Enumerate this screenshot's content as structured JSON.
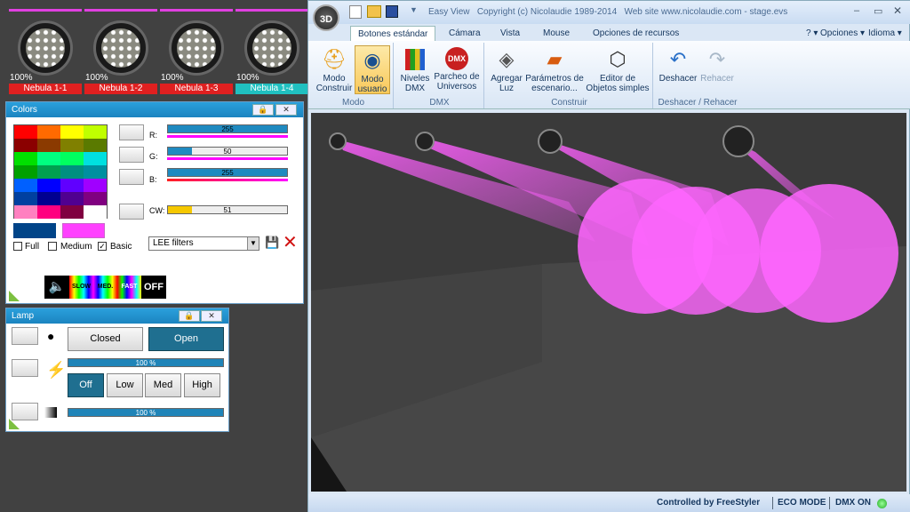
{
  "fixtures": [
    {
      "name": "Nebula 1-1",
      "pct": "100%",
      "selected": false
    },
    {
      "name": "Nebula 1-2",
      "pct": "100%",
      "selected": false
    },
    {
      "name": "Nebula 1-3",
      "pct": "100%",
      "selected": false
    },
    {
      "name": "Nebula 1-4",
      "pct": "100%",
      "selected": true
    }
  ],
  "colors_panel": {
    "title": "Colors",
    "channels": [
      {
        "label": "R:",
        "value": "255",
        "level": 1.0,
        "color": "#ff00ff"
      },
      {
        "label": "G:",
        "value": "50",
        "level": 0.2,
        "color": "#ff00ff"
      },
      {
        "label": "B:",
        "value": "255",
        "level": 1.0,
        "color": "#ff0080"
      }
    ],
    "cw": {
      "label": "CW:",
      "value": "51",
      "level": 0.2
    },
    "palette": [
      "#ff0000",
      "#ff6a00",
      "#ffff00",
      "#c0ff00",
      "#8b0000",
      "#8b3a00",
      "#808000",
      "#5a7a00",
      "#00e000",
      "#00ff80",
      "#00ff60",
      "#00e0e0",
      "#00a000",
      "#00a050",
      "#009080",
      "#0090a0",
      "#0060ff",
      "#0000ff",
      "#6000ff",
      "#a000ff",
      "#0040a0",
      "#000090",
      "#500090",
      "#800080",
      "#ff80c0",
      "#ff0080",
      "#800040",
      "#ffffff"
    ],
    "current_swatch": "#004488",
    "preview_swatch": "#ff40ff",
    "filter_options": {
      "full": "Full",
      "medium": "Medium",
      "basic": "Basic"
    },
    "basic_checked": true,
    "filter_select": "LEE filters",
    "speed_labels": [
      "SLOW",
      "MED.",
      "FAST",
      "OFF"
    ]
  },
  "lamp_panel": {
    "title": "Lamp",
    "closed_label": "Closed",
    "open_label": "Open",
    "shutter_value": "100 %",
    "shutter_level": 1.0,
    "power_buttons": [
      "Off",
      "Low",
      "Med",
      "High"
    ],
    "power_active": "Off",
    "dimmer_value": "100 %",
    "dimmer_level": 1.0
  },
  "window": {
    "title": "Easy View   Copyright (c) Nicolaudie 1989-2014   Web site www.nicolaudie.com - stage.evs",
    "tabs": [
      "Botones estándar",
      "Cámara",
      "Vista",
      "Mouse",
      "Opciones de recursos"
    ],
    "help": "?",
    "options": "Opciones",
    "language": "Idioma",
    "groups": {
      "modo": {
        "label": "Modo",
        "buttons": [
          {
            "l1": "Modo",
            "l2": "Construir",
            "icon": "hardhat-icon"
          },
          {
            "l1": "Modo",
            "l2": "usuario",
            "icon": "eye-icon"
          }
        ]
      },
      "dmx": {
        "label": "DMX",
        "buttons": [
          {
            "l1": "Niveles",
            "l2": "DMX",
            "icon": "levels-icon"
          },
          {
            "l1": "Parcheo de",
            "l2": "Universos",
            "icon": "dmx-patch-icon"
          }
        ]
      },
      "construir": {
        "label": "Construir",
        "buttons": [
          {
            "l1": "Agregar",
            "l2": "Luz",
            "icon": "spotlight-icon"
          },
          {
            "l1": "Parámetros de",
            "l2": "escenario...",
            "icon": "stage-icon"
          },
          {
            "l1": "Editor de",
            "l2": "Objetos simples",
            "icon": "cube-icon"
          }
        ]
      },
      "undo": {
        "label": "Deshacer / Rehacer",
        "buttons": [
          {
            "l1": "Deshacer",
            "l2": "",
            "icon": "undo-icon"
          },
          {
            "l1": "Rehacer",
            "l2": "",
            "icon": "redo-icon"
          }
        ]
      }
    },
    "status": {
      "controlled": "Controlled by FreeStyler",
      "eco": "ECO MODE",
      "dmx": "DMX ON"
    }
  }
}
